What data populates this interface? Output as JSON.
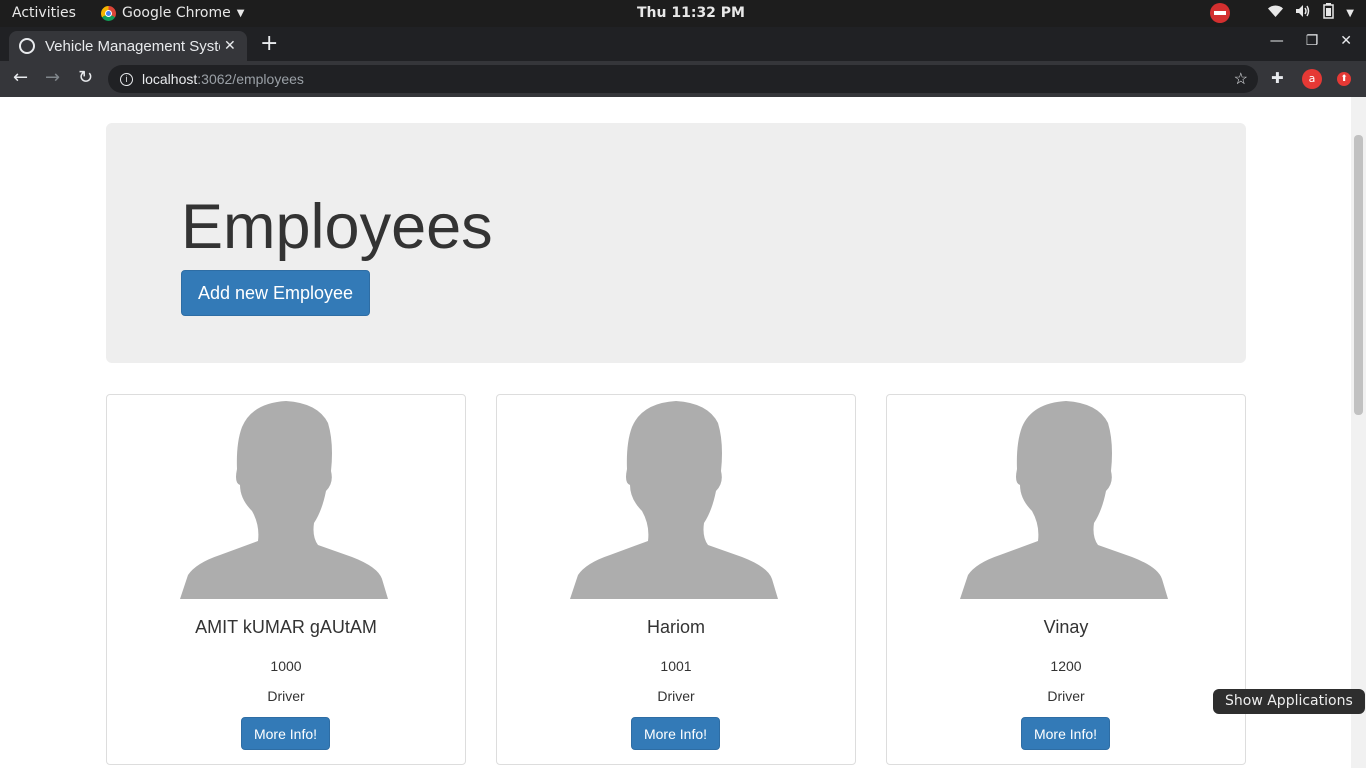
{
  "topbar": {
    "activities": "Activities",
    "app_name": "Google Chrome",
    "clock": "Thu 11:32 PM"
  },
  "browser": {
    "tab_title": "Vehicle Management System",
    "url_host": "localhost",
    "url_rest": ":3062/employees",
    "extension_badge": "a"
  },
  "page": {
    "heading": "Employees",
    "add_button": "Add new Employee",
    "employees": [
      {
        "name": "AMIT kUMAR gAUtAM",
        "id": "1000",
        "role": "Driver",
        "button": "More Info!"
      },
      {
        "name": "Hariom",
        "id": "1001",
        "role": "Driver",
        "button": "More Info!"
      },
      {
        "name": "Vinay",
        "id": "1200",
        "role": "Driver",
        "button": "More Info!"
      }
    ]
  },
  "tooltip": "Show Applications",
  "colors": {
    "primary": "#337ab7",
    "jumbotron": "#eeeeee",
    "avatar": "#adadad"
  }
}
